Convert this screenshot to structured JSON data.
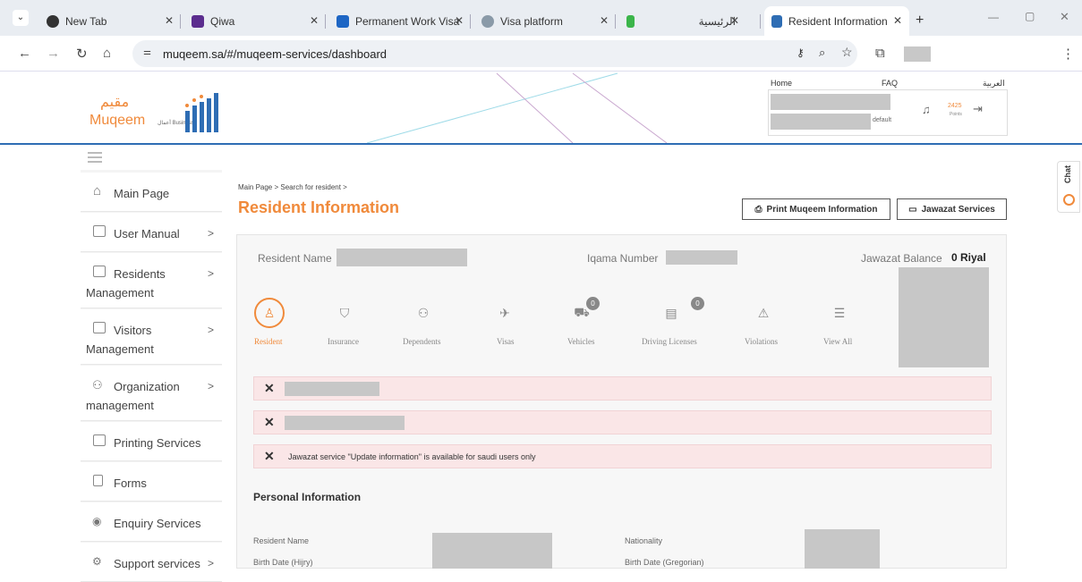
{
  "browser": {
    "tabs": [
      {
        "label": "New Tab"
      },
      {
        "label": "Qiwa"
      },
      {
        "label": "Permanent Work Visa"
      },
      {
        "label": "Visa platform"
      },
      {
        "label": ""
      },
      {
        "label": "الرئيسية"
      },
      {
        "label": "Resident Information",
        "active": true
      }
    ],
    "url": "muqeem.sa/#/muqeem-services/dashboard"
  },
  "header": {
    "logo_ar": "مقيم",
    "logo_en": "Muqeem",
    "logo_business": "أعمال Business",
    "links": {
      "home": "Home",
      "faq": "FAQ",
      "arabic": "العربية"
    },
    "user_default": "default",
    "points_value": "2425",
    "points_label": "Points"
  },
  "sidebar": {
    "items": [
      {
        "label": "Main Page",
        "icon": "home-icon"
      },
      {
        "label": "User Manual",
        "icon": "book-icon",
        "chevron": true
      },
      {
        "label": "Residents",
        "line2": "Management",
        "icon": "id-card-icon",
        "chevron": true
      },
      {
        "label": "Visitors",
        "line2": "Management",
        "icon": "id-card-icon",
        "chevron": true
      },
      {
        "label": "Organization",
        "line2": "management",
        "icon": "org-chart-icon",
        "chevron": true
      },
      {
        "label": "Printing Services",
        "icon": "printer-icon"
      },
      {
        "label": "Forms",
        "icon": "document-icon"
      },
      {
        "label": "Enquiry Services",
        "icon": "eye-icon"
      },
      {
        "label": "Support services",
        "icon": "support-icon",
        "chevron": true
      }
    ]
  },
  "main": {
    "breadcrumb": "Main Page  >  Search for resident  >",
    "title": "Resident Information",
    "print_button": "Print Muqeem Information",
    "jawazat_button": "Jawazat Services",
    "resident_name_label": "Resident Name",
    "iqama_label": "Iqama Number",
    "jawazat_balance_label": "Jawazat Balance",
    "jawazat_balance_value": "0 Riyal",
    "steps": [
      {
        "label": "Resident",
        "icon": "user-icon",
        "active": true
      },
      {
        "label": "Insurance",
        "icon": "shield-icon"
      },
      {
        "label": "Dependents",
        "icon": "group-icon"
      },
      {
        "label": "Visas",
        "icon": "plane-icon"
      },
      {
        "label": "Vehicles",
        "icon": "car-icon",
        "badge": "0"
      },
      {
        "label": "Driving Licenses",
        "icon": "license-icon",
        "badge": "0"
      },
      {
        "label": "Violations",
        "icon": "warning-icon"
      },
      {
        "label": "View All",
        "icon": "list-icon"
      }
    ],
    "alerts": [
      {
        "text": ""
      },
      {
        "text": ""
      },
      {
        "text": "Jawazat service \"Update information\" is available for saudi users only"
      }
    ],
    "personal_info_title": "Personal Information",
    "fields": {
      "resident_name": "Resident Name",
      "nationality": "Nationality",
      "birth_hijri": "Birth Date (Hijry)",
      "birth_greg": "Birth Date (Gregorian)"
    }
  },
  "chat": {
    "label": "Chat"
  }
}
